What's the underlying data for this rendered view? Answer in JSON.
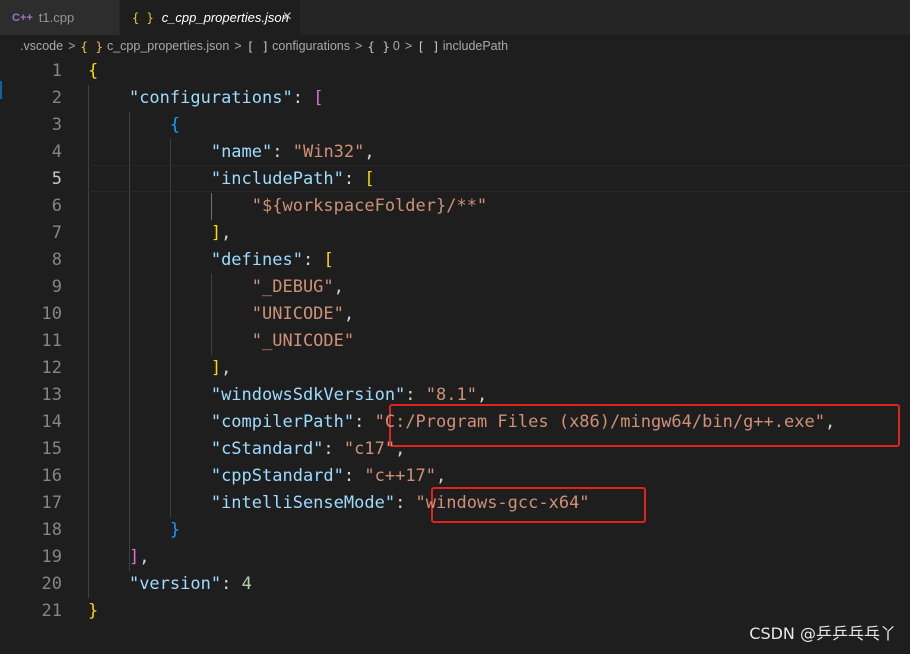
{
  "tabs": [
    {
      "icon": "C++",
      "label": "t1.cpp"
    },
    {
      "icon": "{ }",
      "label": "c_cpp_properties.json",
      "close": "×"
    }
  ],
  "breadcrumb": {
    "folder": ".vscode",
    "file_icon": "{ }",
    "file": "c_cpp_properties.json",
    "seg1_icon": "[ ]",
    "seg1": "configurations",
    "seg2_icon": "{ }",
    "seg2": "0",
    "seg3_icon": "[ ]",
    "seg3": "includePath",
    "sep": ">"
  },
  "lines": [
    {
      "num": "1",
      "tokens": [
        [
          "b1",
          "{"
        ]
      ]
    },
    {
      "num": "2",
      "tokens": [
        [
          "p",
          "    "
        ],
        [
          "k",
          "\"configurations\""
        ],
        [
          "p",
          ": "
        ],
        [
          "b2",
          "["
        ]
      ]
    },
    {
      "num": "3",
      "tokens": [
        [
          "p",
          "        "
        ],
        [
          "b3",
          "{"
        ]
      ]
    },
    {
      "num": "4",
      "tokens": [
        [
          "p",
          "            "
        ],
        [
          "k",
          "\"name\""
        ],
        [
          "p",
          ": "
        ],
        [
          "s",
          "\"Win32\""
        ],
        [
          "p",
          ","
        ]
      ]
    },
    {
      "num": "5",
      "tokens": [
        [
          "p",
          "            "
        ],
        [
          "k",
          "\"includePath\""
        ],
        [
          "p",
          ": "
        ],
        [
          "b1",
          "["
        ]
      ]
    },
    {
      "num": "6",
      "tokens": [
        [
          "p",
          "                "
        ],
        [
          "s",
          "\"${workspaceFolder}/**\""
        ]
      ]
    },
    {
      "num": "7",
      "tokens": [
        [
          "p",
          "            "
        ],
        [
          "b1",
          "]"
        ],
        [
          "p",
          ","
        ]
      ]
    },
    {
      "num": "8",
      "tokens": [
        [
          "p",
          "            "
        ],
        [
          "k",
          "\"defines\""
        ],
        [
          "p",
          ": "
        ],
        [
          "b1",
          "["
        ]
      ]
    },
    {
      "num": "9",
      "tokens": [
        [
          "p",
          "                "
        ],
        [
          "s",
          "\"_DEBUG\""
        ],
        [
          "p",
          ","
        ]
      ]
    },
    {
      "num": "10",
      "tokens": [
        [
          "p",
          "                "
        ],
        [
          "s",
          "\"UNICODE\""
        ],
        [
          "p",
          ","
        ]
      ]
    },
    {
      "num": "11",
      "tokens": [
        [
          "p",
          "                "
        ],
        [
          "s",
          "\"_UNICODE\""
        ]
      ]
    },
    {
      "num": "12",
      "tokens": [
        [
          "p",
          "            "
        ],
        [
          "b1",
          "]"
        ],
        [
          "p",
          ","
        ]
      ]
    },
    {
      "num": "13",
      "tokens": [
        [
          "p",
          "            "
        ],
        [
          "k",
          "\"windowsSdkVersion\""
        ],
        [
          "p",
          ": "
        ],
        [
          "s",
          "\"8.1\""
        ],
        [
          "p",
          ","
        ]
      ]
    },
    {
      "num": "14",
      "tokens": [
        [
          "p",
          "            "
        ],
        [
          "k",
          "\"compilerPath\""
        ],
        [
          "p",
          ": "
        ],
        [
          "s",
          "\"C:/Program Files (x86)/mingw64/bin/g++.exe\""
        ],
        [
          "p",
          ","
        ]
      ]
    },
    {
      "num": "15",
      "tokens": [
        [
          "p",
          "            "
        ],
        [
          "k",
          "\"cStandard\""
        ],
        [
          "p",
          ": "
        ],
        [
          "s",
          "\"c17\""
        ],
        [
          "p",
          ","
        ]
      ]
    },
    {
      "num": "16",
      "tokens": [
        [
          "p",
          "            "
        ],
        [
          "k",
          "\"cppStandard\""
        ],
        [
          "p",
          ": "
        ],
        [
          "s",
          "\"c++17\""
        ],
        [
          "p",
          ","
        ]
      ]
    },
    {
      "num": "17",
      "tokens": [
        [
          "p",
          "            "
        ],
        [
          "k",
          "\"intelliSenseMode\""
        ],
        [
          "p",
          ": "
        ],
        [
          "s",
          "\"windows-gcc-x64\""
        ]
      ]
    },
    {
      "num": "18",
      "tokens": [
        [
          "p",
          "        "
        ],
        [
          "b3",
          "}"
        ]
      ]
    },
    {
      "num": "19",
      "tokens": [
        [
          "p",
          "    "
        ],
        [
          "b2",
          "]"
        ],
        [
          "p",
          ","
        ]
      ]
    },
    {
      "num": "20",
      "tokens": [
        [
          "p",
          "    "
        ],
        [
          "k",
          "\"version\""
        ],
        [
          "p",
          ": "
        ],
        [
          "n",
          "4"
        ]
      ]
    },
    {
      "num": "21",
      "tokens": [
        [
          "b1",
          "}"
        ]
      ]
    }
  ],
  "watermark": "CSDN @乒乒乓乓丫",
  "colors": {
    "highlight_box": "#e0231c",
    "string": "#ce9178",
    "key": "#9cdcfe",
    "number": "#b5cea8"
  }
}
